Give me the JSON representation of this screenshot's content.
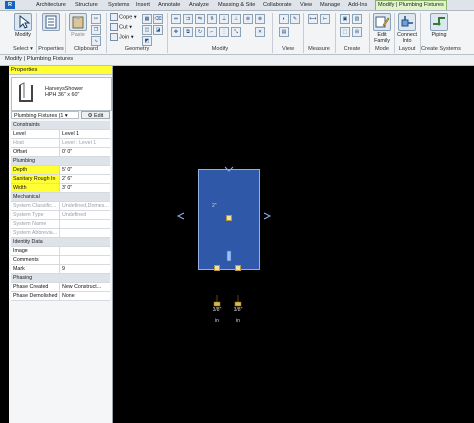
{
  "ribbon": {
    "tabs": [
      {
        "label": "R",
        "file": true
      },
      {
        "label": "Architecture"
      },
      {
        "label": "Structure"
      },
      {
        "label": "Systems"
      },
      {
        "label": "Insert"
      },
      {
        "label": "Annotate"
      },
      {
        "label": "Analyze"
      },
      {
        "label": "Massing & Site"
      },
      {
        "label": "Collaborate"
      },
      {
        "label": "View"
      },
      {
        "label": "Manage"
      },
      {
        "label": "Add-Ins"
      },
      {
        "label": "Modify | Plumbing Fixtures",
        "active": true
      }
    ],
    "panels": {
      "select": {
        "button": "Modify",
        "label": "Select ▾"
      },
      "properties": {
        "label": "Properties"
      },
      "clipboard": {
        "paste": "Paste",
        "label": "Clipboard"
      },
      "geometry": {
        "cope": "Cope ▾",
        "cut": "Cut ▾",
        "join": "Join ▾",
        "label": "Geometry"
      },
      "modify": {
        "label": "Modify"
      },
      "view": {
        "label": "View"
      },
      "measure": {
        "label": "Measure"
      },
      "create": {
        "label": "Create"
      },
      "mode": {
        "button_line1": "Edit",
        "button_line2": "Family",
        "label": "Mode"
      },
      "layout": {
        "button_line1": "Connect",
        "button_line2": "Into",
        "label": "Layout"
      },
      "create_systems": {
        "button": "Piping",
        "label": "Create Systems"
      }
    }
  },
  "options_bar": {
    "text": "Modify | Plumbing Fixtures"
  },
  "properties": {
    "title": "Properties",
    "type_name_line1": "HarveysShower",
    "type_name_line2": "HPH 36\" x 60\"",
    "type_selector": "Plumbing Fixtures (1 ▾",
    "edit_type": "Edit Type",
    "rows": [
      {
        "kind": "group",
        "name": "Constraints"
      },
      {
        "name": "Level",
        "value": "Level 1"
      },
      {
        "name": "Host",
        "value": "Level : Level 1",
        "dim": true
      },
      {
        "name": "Offset",
        "value": "0'  0\""
      },
      {
        "kind": "group",
        "name": "Plumbing"
      },
      {
        "name": "Depth",
        "value": "5'  0\"",
        "hl": true
      },
      {
        "name": "Sanitary Rough In",
        "value": "2'  6\"",
        "hl": true
      },
      {
        "name": "Width",
        "value": "3'  0\"",
        "hl": true
      },
      {
        "kind": "group",
        "name": "Mechanical"
      },
      {
        "name": "System Classific...",
        "value": "Undefined,Domes...",
        "dim": true
      },
      {
        "name": "System Type",
        "value": "Undefined",
        "dim": true
      },
      {
        "name": "System Name",
        "value": "",
        "dim": true
      },
      {
        "name": "System Abbrevia...",
        "value": "",
        "dim": true
      },
      {
        "kind": "group",
        "name": "Identity Data"
      },
      {
        "name": "Image",
        "value": ""
      },
      {
        "name": "Comments",
        "value": ""
      },
      {
        "name": "Mark",
        "value": "9"
      },
      {
        "kind": "group",
        "name": "Phasing"
      },
      {
        "name": "Phase Created",
        "value": "New Construct..."
      },
      {
        "name": "Phase Demolished",
        "value": "None"
      }
    ]
  },
  "canvas": {
    "dim_top": "2\"",
    "connector_labels": [
      "3/8\"",
      "3/8\""
    ],
    "connector_units": [
      "in",
      "in"
    ],
    "colors": {
      "fixture": "#2f58a8",
      "background": "#000000",
      "highlight": "#ffff33"
    }
  }
}
